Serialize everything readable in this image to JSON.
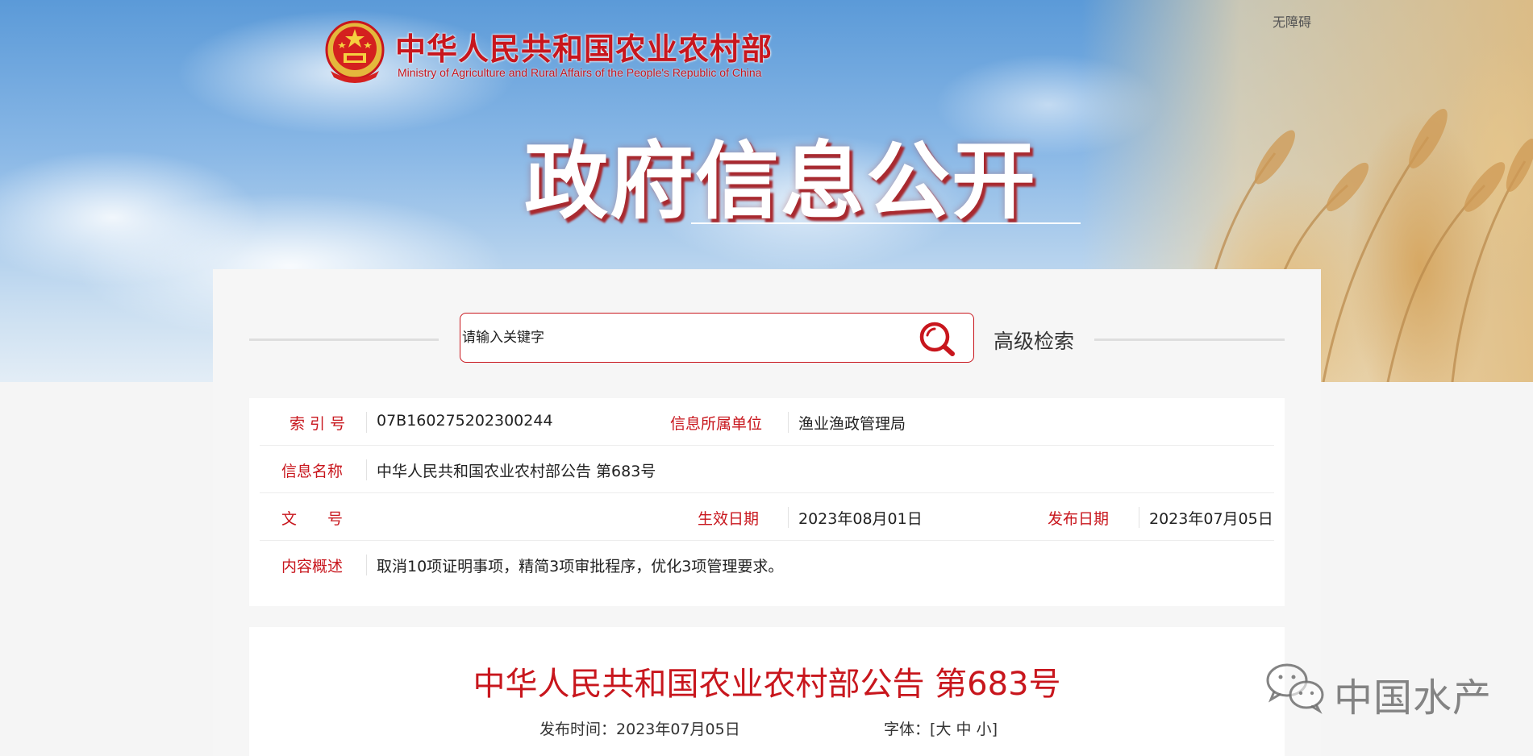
{
  "header": {
    "accessibility_link": "无障碍",
    "site_name_cn": "中华人民共和国农业农村部",
    "site_name_en": "Ministry of Agriculture and Rural Affairs of the People's Republic of China",
    "banner_title": "政府信息公开"
  },
  "search": {
    "placeholder": "请输入关键字",
    "advanced_label": "高级检索"
  },
  "meta": {
    "index_label": "索 引 号",
    "index_value": "07B160275202300244",
    "unit_label": "信息所属单位",
    "unit_value": "渔业渔政管理局",
    "name_label": "信息名称",
    "name_value": "中华人民共和国农业农村部公告 第683号",
    "doc_label": "文　　号",
    "doc_value": "",
    "effective_label": "生效日期",
    "effective_value": "2023年08月01日",
    "publish_label": "发布日期",
    "publish_value": "2023年07月05日",
    "summary_label": "内容概述",
    "summary_value": "取消10项证明事项，精简3项审批程序，优化3项管理要求。"
  },
  "article": {
    "title": "中华人民共和国农业农村部公告 第683号",
    "pub_time_label": "发布时间：",
    "pub_time_value": "2023年07月05日",
    "font_label": "字体：",
    "font_open": "[",
    "font_large": "大",
    "font_medium": "中",
    "font_small": "小",
    "font_close": "]"
  },
  "watermark": {
    "text": "中国水产"
  },
  "colors": {
    "brand_red": "#c8161d",
    "panel_bg": "#f6f6f6"
  }
}
